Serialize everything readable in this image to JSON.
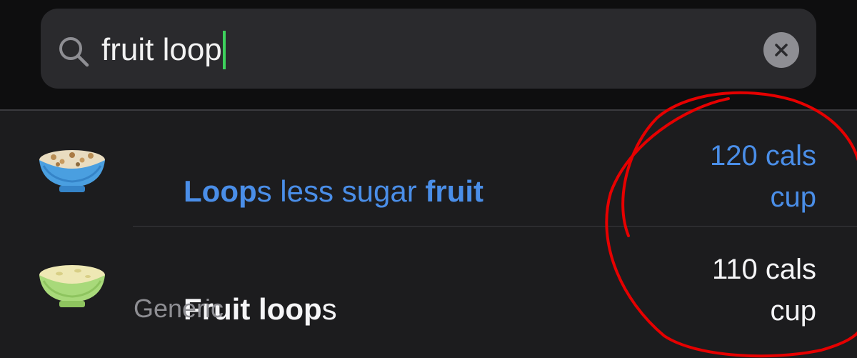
{
  "search": {
    "value": "fruit loop",
    "icon": "search-icon",
    "clear_icon": "close-icon",
    "caret_color": "#3dd15c"
  },
  "results": [
    {
      "title_parts": [
        {
          "text": "Loop",
          "bold": true
        },
        {
          "text": "s less sugar ",
          "bold": false
        },
        {
          "text": "fruit",
          "bold": true
        }
      ],
      "subtitle": "",
      "calories": "120 cals",
      "unit": "cup",
      "color": "#4a8ee8",
      "icon": "cereal-bowl-blue-icon"
    },
    {
      "title_parts": [
        {
          "text": "Fruit loop",
          "bold": true
        },
        {
          "text": "s",
          "bold": false
        }
      ],
      "subtitle": "Generic",
      "calories": "110 cals",
      "unit": "cup",
      "color": "#f5f5f7",
      "icon": "cereal-bowl-green-icon"
    }
  ],
  "annotation": {
    "type": "hand-drawn-circle",
    "color": "#e60000"
  }
}
